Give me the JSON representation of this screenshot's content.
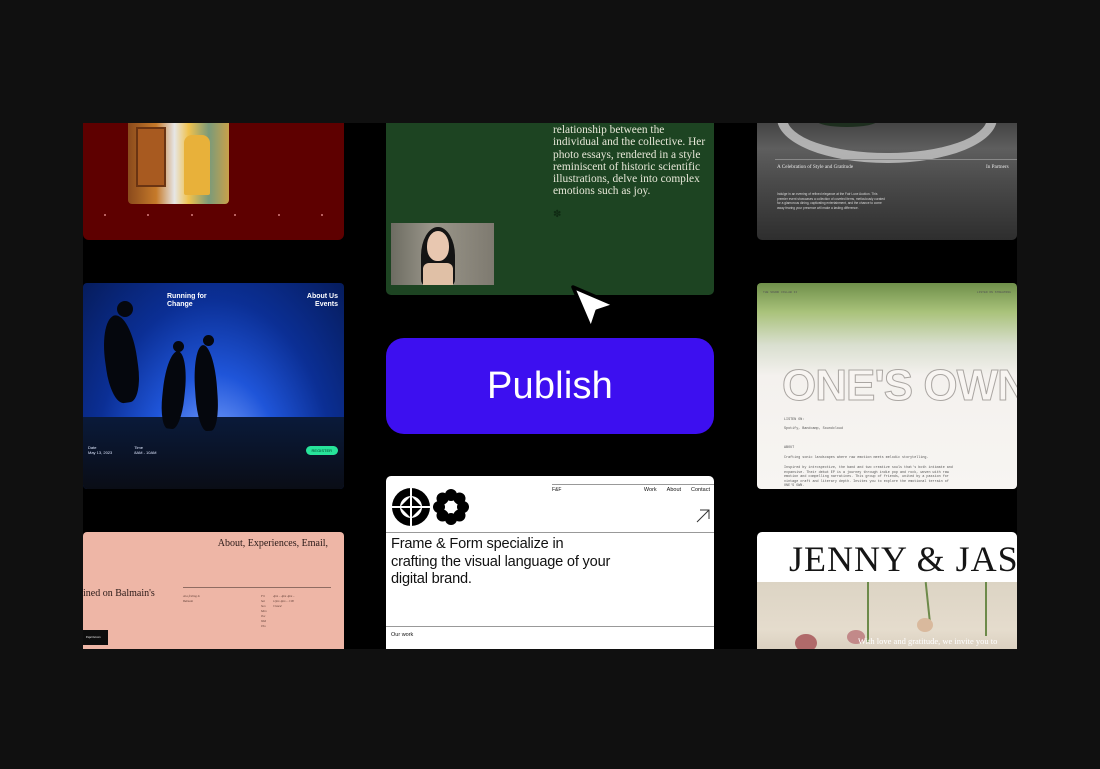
{
  "publish": {
    "label": "Publish"
  },
  "cards": {
    "green": {
      "text": "relationship between the individual and the collective. Her photo essays, rendered in a style reminiscent of historic scientific illustrations, delve into complex emotions such as joy."
    },
    "running": {
      "title": "Running for Change",
      "nav": "About Us\nEvents",
      "date_label": "Date",
      "date_value": "May 13, 2023",
      "time_label": "Time",
      "time_value": "8AM - 10AM",
      "cta": "REGISTER"
    },
    "pink": {
      "nav": "About, Experiences, Email,",
      "hero": "ined on Balmain's",
      "col1": "At a feeling in Balmain",
      "col2": "Fri Sat Sun Mon Tue Wed Thu",
      "col3": "4pm – 4pm  4pm – 11pm  4pm – 1:00  Closed",
      "button": "Experiences"
    },
    "frame": {
      "brand": "F&F",
      "nav": [
        "Work",
        "About",
        "Contact"
      ],
      "headline": "Frame & Form specialize in crafting the visual language of your digital brand.",
      "ourwork": "Our work"
    },
    "grey": {
      "title": "A Celebration of Style and Gratitude",
      "title2": "In Partners",
      "body": "Indulge in an evening of refined elegance at the Fair Luxe Auction. This premier event showcases a collection of coveted items, meticulously curated for a glamorous dining, captivating entertainment, and the chance to come away fearing your presence will make a lasting difference."
    },
    "onesown": {
      "header_left": "THE SOUND COLLAB II",
      "header_right": "LISTEN ON STREAMING",
      "big": "ONE'S OWN",
      "listen": "LISTEN ON:",
      "platforms": "Spotify, Bandcamp, Soundcloud",
      "about": "ABOUT",
      "p1": "Crafting sonic landscapes where raw emotion meets melodic storytelling.",
      "p2": "Inspired by introspective, the band and two creative souls that's both intimate and expansive. Their debut EP is a journey through indie pop and rock, woven with raw emotion and compelling narratives. This group of friends, united by a passion for vintage craft and literary depth. Invites you to explore the emotional terrain of ONE'S OWN."
    },
    "jenny": {
      "name": "JENNY & JASO",
      "tagline": "With love and gratitude, we invite you to"
    }
  }
}
